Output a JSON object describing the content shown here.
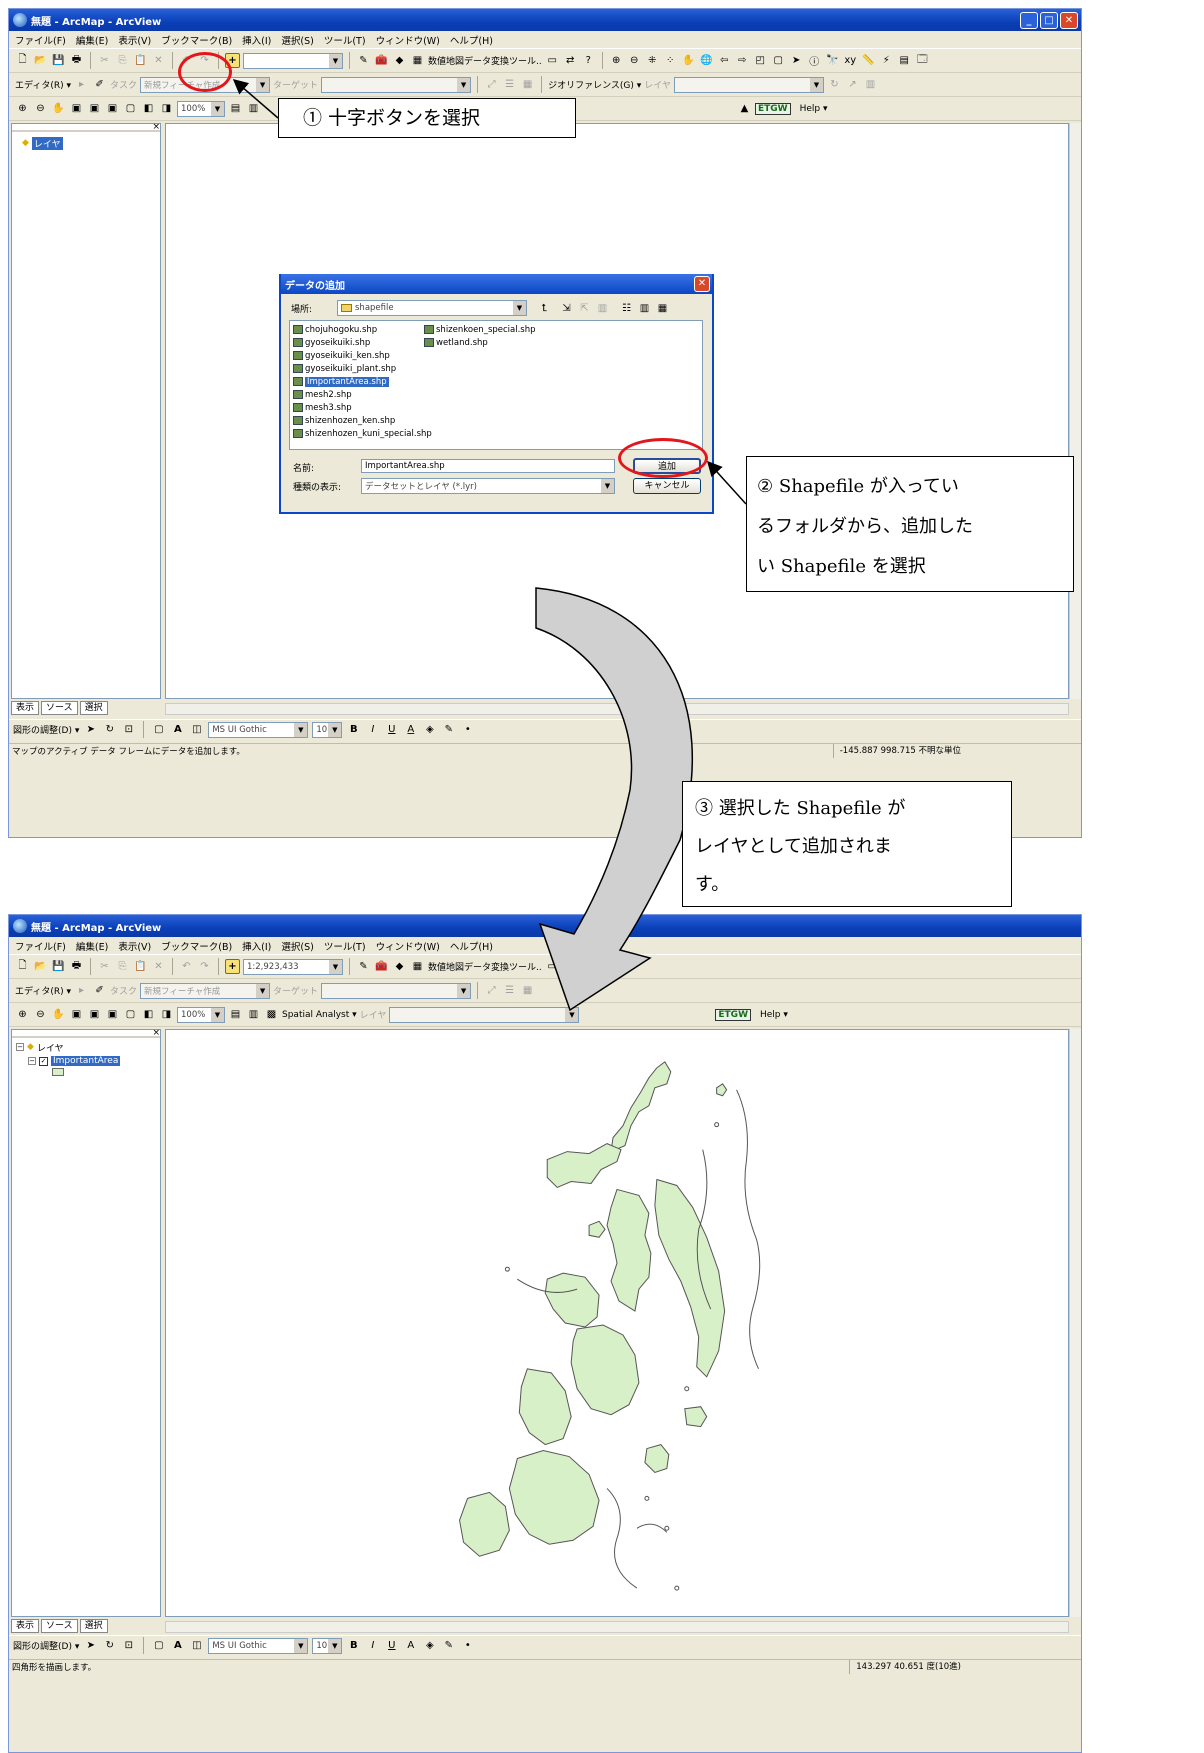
{
  "window": {
    "title": "無題 - ArcMap - ArcView",
    "min": "_",
    "max": "□",
    "close": "✕"
  },
  "menu": [
    "ファイル(F)",
    "編集(E)",
    "表示(V)",
    "ブックマーク(B)",
    "挿入(I)",
    "選択(S)",
    "ツール(T)",
    "ウィンドウ(W)",
    "ヘルプ(H)"
  ],
  "toolbar": {
    "data_convert_tool": "数値地図データ変換ツール..",
    "editor_menu": "エディタ(R) ▾",
    "task_label": "タスク",
    "task_value": "新規フィーチャ作成",
    "target_label": "ターゲット",
    "georef_menu": "ジオリファレンス(G) ▾",
    "layer_label": "レイヤ",
    "zoom_value": "100%",
    "spatial_analyst": "Spatial Analyst ▾",
    "etgw_label": "ETGW",
    "help_menu": "Help ▾",
    "scale_value_top": "",
    "scale_value_bottom": "1:2,923,433"
  },
  "toc": {
    "root_layer": "レイヤ",
    "added_layer": "ImportantArea",
    "tabs": [
      "表示",
      "ソース",
      "選択"
    ]
  },
  "drawing_toolbar": {
    "adjust_label": "図形の調整(D) ▾",
    "font_name": "MS UI Gothic",
    "font_size": "10",
    "bold": "B",
    "italic": "I",
    "underline": "U",
    "text_a": "A"
  },
  "status": {
    "top_message": "マップのアクティブ データ フレームにデータを追加します。",
    "top_coords": "-145.887  998.715 不明な単位",
    "bottom_message": "四角形を描画します。",
    "bottom_coords": "143.297  40.651 度(10進)"
  },
  "add_data_dialog": {
    "title": "データの追加",
    "location_label": "場所:",
    "location_value": "shapefile",
    "files_col1": [
      "chojuhogoku.shp",
      "gyoseikuiki.shp",
      "gyoseikuiki_ken.shp",
      "gyoseikuiki_plant.shp",
      "ImportantArea.shp",
      "mesh2.shp",
      "mesh3.shp",
      "shizenhozen_ken.shp",
      "shizenhozen_kuni_special.shp"
    ],
    "files_col2": [
      "shizenkoen_special.shp",
      "wetland.shp"
    ],
    "name_label": "名前:",
    "name_value": "ImportantArea.shp",
    "type_label": "種類の表示:",
    "type_value": "データセットとレイヤ (*.lyr)",
    "add_button": "追加",
    "cancel_button": "キャンセル"
  },
  "callouts": {
    "step1": "① 十字ボタンを選択",
    "step2_line1": "② Shapefile が入ってい",
    "step2_line2": "るフォルダから、追加した",
    "step2_line3": "い Shapefile を選択",
    "step3_line1": "③ 選択した Shapefile が",
    "step3_line2": "レイヤとして追加されま",
    "step3_line3": "す。"
  },
  "colors": {
    "accent_red": "#e3171b",
    "polygon_fill": "#d8f0c8",
    "titlebar_blue": "#0a3fb8"
  }
}
